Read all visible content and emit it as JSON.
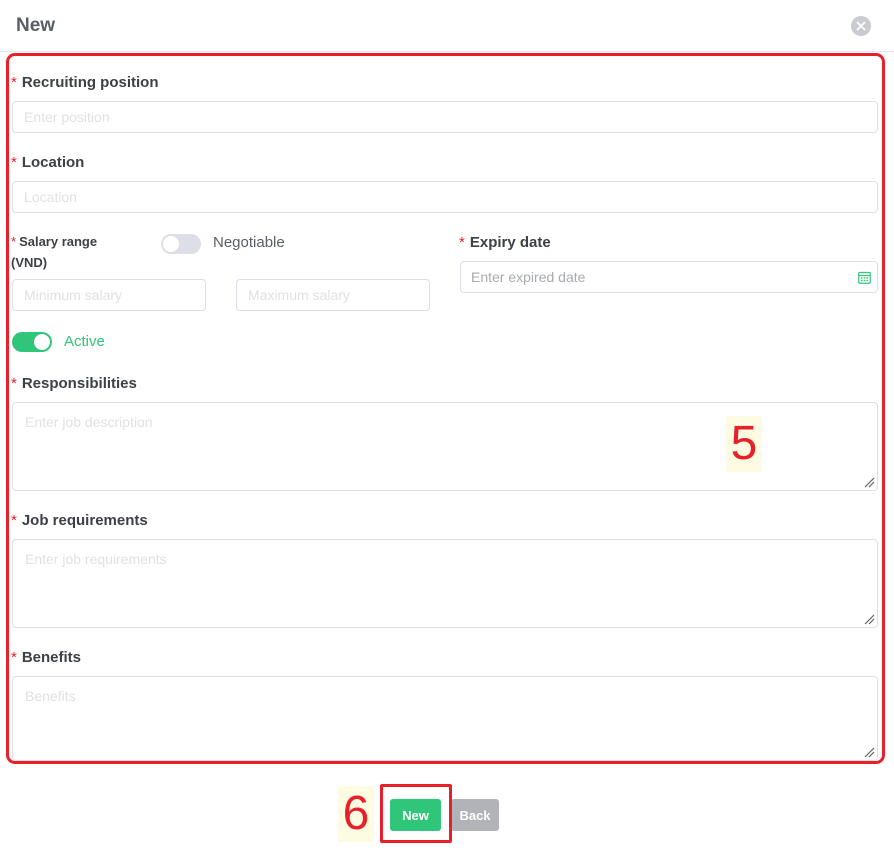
{
  "dialog": {
    "title": "New",
    "close_icon": "close-circle-icon"
  },
  "form": {
    "required_mark": "*",
    "position": {
      "label": "Recruiting position",
      "placeholder": "Enter position"
    },
    "location": {
      "label": "Location",
      "placeholder": "Location"
    },
    "salary": {
      "label_line1": "Salary range",
      "label_line2": "(VND)",
      "min_placeholder": "Minimum salary",
      "max_placeholder": "Maximum salary",
      "negotiable_label": "Negotiable",
      "negotiable_on": false
    },
    "expiry": {
      "label": "Expiry date",
      "placeholder": "Enter expired date",
      "icon": "calendar-icon"
    },
    "active": {
      "label": "Active",
      "on": true
    },
    "responsibilities": {
      "label": "Responsibilities",
      "placeholder": "Enter job description"
    },
    "requirements": {
      "label": "Job requirements",
      "placeholder": "Enter job requirements"
    },
    "benefits": {
      "label": "Benefits",
      "placeholder": "Benefits"
    }
  },
  "actions": {
    "new_label": "New",
    "back_label": "Back"
  },
  "annotations": {
    "form_number": "5",
    "button_number": "6",
    "color": "#e8202a"
  },
  "colors": {
    "accent": "#2fc67a",
    "required": "#e8202a",
    "secondary_button": "#b1b3b8"
  }
}
